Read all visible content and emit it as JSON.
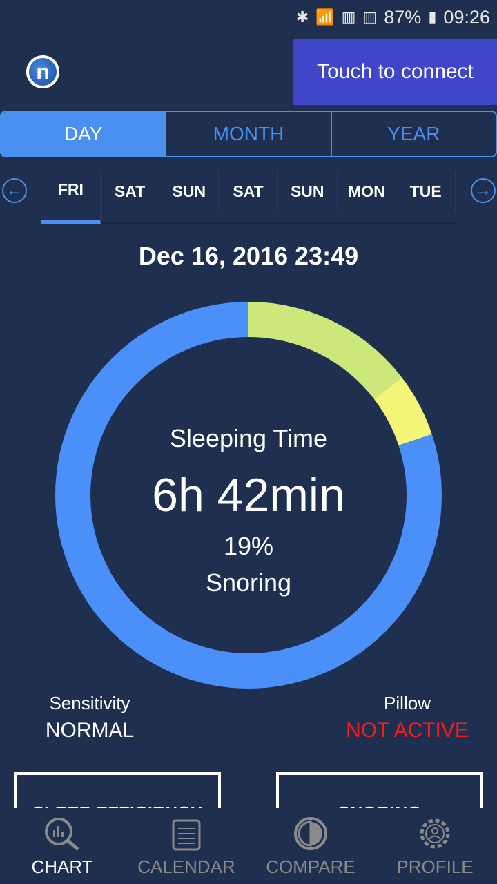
{
  "status": {
    "battery": "87%",
    "time": "09:26"
  },
  "header": {
    "logo": "n",
    "connect_label": "Touch to connect"
  },
  "tabs": [
    {
      "label": "DAY",
      "active": true
    },
    {
      "label": "MONTH"
    },
    {
      "label": "YEAR"
    }
  ],
  "days": [
    "FRI",
    "SAT",
    "SUN",
    "SAT",
    "SUN",
    "MON",
    "TUE"
  ],
  "selected_day": "FRI",
  "date": "Dec 16, 2016 23:49",
  "summary": {
    "title": "Sleeping Time",
    "duration": "6h 42min",
    "percent": "19%",
    "label": "Snoring"
  },
  "donut": {
    "segments": [
      {
        "fraction": 0.146,
        "color": "#cce87a"
      },
      {
        "fraction": 0.053,
        "color": "#f5f57a"
      },
      {
        "fraction": 0.801,
        "color": "#4a90f8"
      }
    ]
  },
  "sensitivity": {
    "label": "Sensitivity",
    "value": "NORMAL"
  },
  "pillow": {
    "label": "Pillow",
    "value": "NOT ACTIVE",
    "color": "#ff1a1a"
  },
  "cards": [
    "SLEEP EFFICIENCY",
    "SNORING"
  ],
  "nav": [
    {
      "label": "CHART",
      "icon": "chart-search-icon",
      "active": true
    },
    {
      "label": "CALENDAR",
      "icon": "calendar-icon"
    },
    {
      "label": "COMPARE",
      "icon": "compare-icon"
    },
    {
      "label": "PROFILE",
      "icon": "profile-gear-icon"
    }
  ]
}
